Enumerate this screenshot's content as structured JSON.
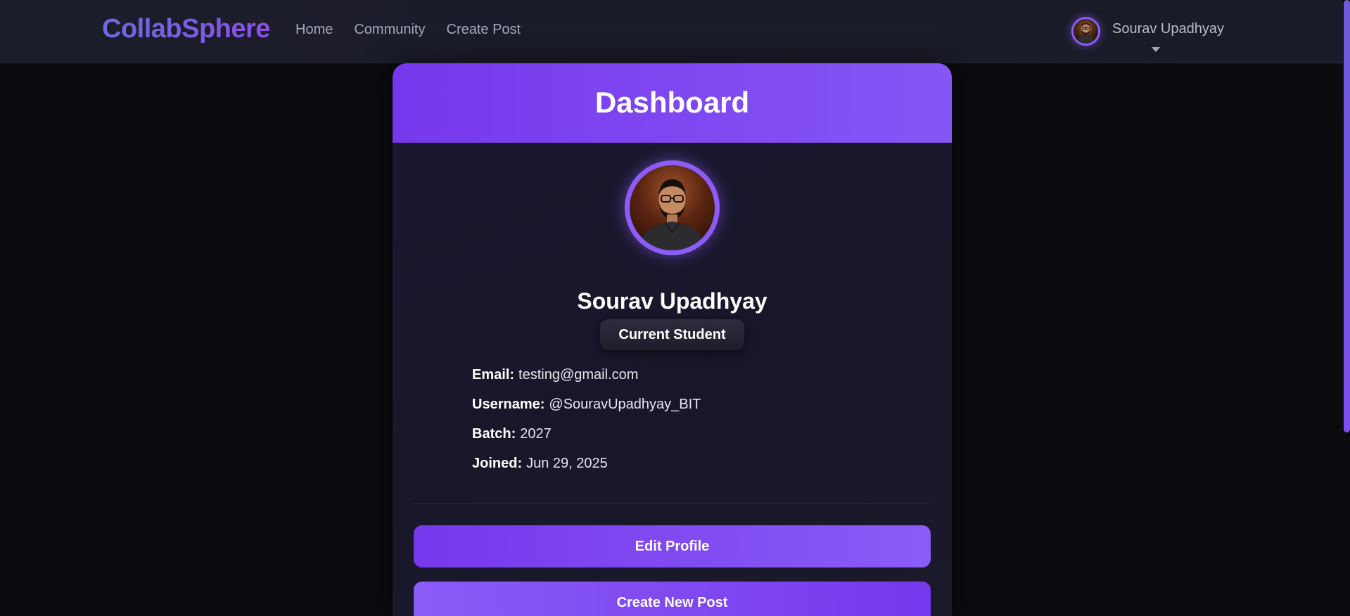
{
  "navbar": {
    "brand": "CollabSphere",
    "links": [
      "Home",
      "Community",
      "Create Post"
    ],
    "user_name": "Sourav Upadhyay"
  },
  "dashboard": {
    "title": "Dashboard",
    "profile_name": "Sourav Upadhyay",
    "status_badge": "Current Student",
    "info": [
      {
        "label": "Email:",
        "value": "testing@gmail.com"
      },
      {
        "label": "Username:",
        "value": "@SouravUpadhyay_BIT"
      },
      {
        "label": "Batch:",
        "value": "2027"
      },
      {
        "label": "Joined:",
        "value": "Jun 29, 2025"
      }
    ],
    "buttons": {
      "edit_profile": "Edit Profile",
      "create_post": "Create New Post"
    }
  },
  "colors": {
    "accent": "#8b5cf6",
    "header_gradient_start": "#7638ec",
    "background": "#0b0b10"
  },
  "icons": {
    "nav_avatar": "user-avatar-photo",
    "profile_avatar": "profile-photo",
    "caret": "chevron-down-icon"
  }
}
